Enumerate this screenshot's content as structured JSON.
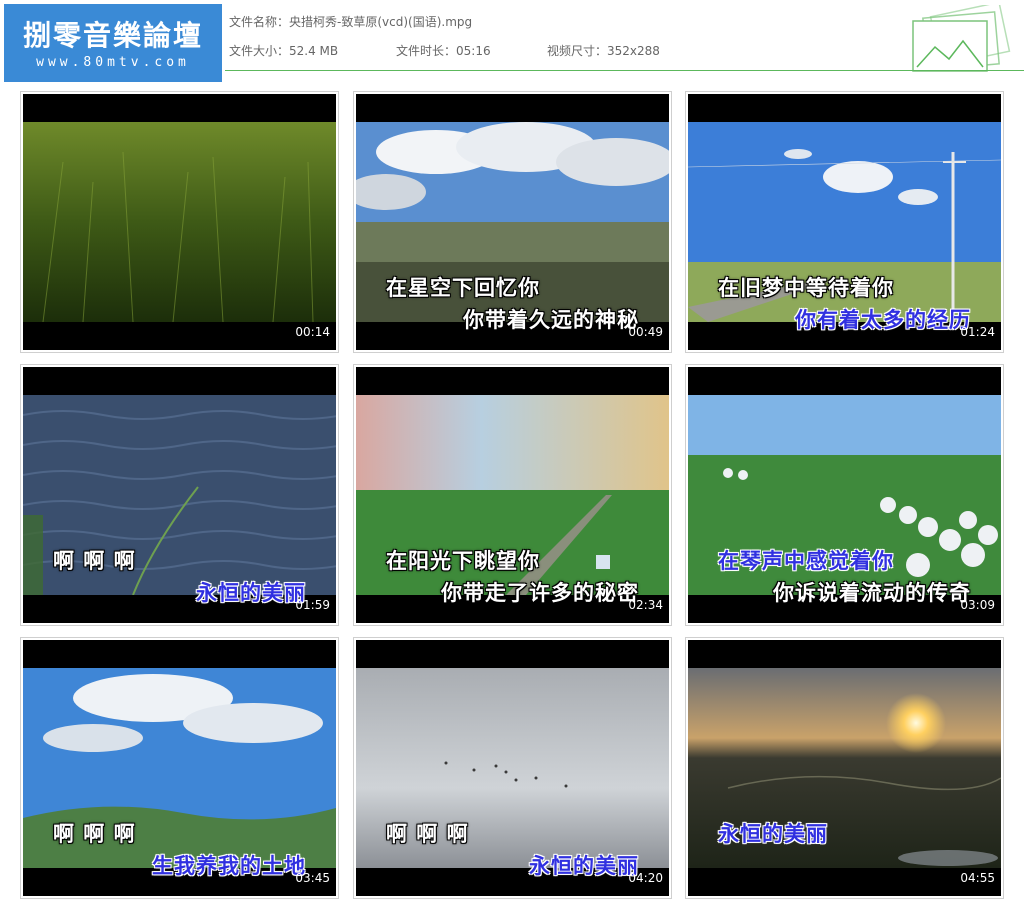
{
  "logo": {
    "title": "捌零音樂論壇",
    "url": "www.80mtv.com"
  },
  "file_info": {
    "name_label": "文件名称：",
    "name_value": "央措柯秀-致草原(vcd)(国语).mpg",
    "size_label": "文件大小：",
    "size_value": "52.4 MB",
    "duration_label": "文件时长：",
    "duration_value": "05:16",
    "resolution_label": "视频尺寸：",
    "resolution_value": "352x288"
  },
  "thumbnails": [
    {
      "time": "00:14",
      "lyric_line1": "",
      "lyric_line2": ""
    },
    {
      "time": "00:49",
      "lyric_line1": "在星空下回忆你",
      "lyric_line2": "你带着久远的神秘"
    },
    {
      "time": "01:24",
      "lyric_line1": "在旧梦中等待着你",
      "lyric_line2": "你有着太多的经历"
    },
    {
      "time": "01:59",
      "lyric_line1": "啊 啊 啊",
      "lyric_line2": "永恒的美丽"
    },
    {
      "time": "02:34",
      "lyric_line1": "在阳光下眺望你",
      "lyric_line2": "你带走了许多的秘密"
    },
    {
      "time": "03:09",
      "lyric_line1": "在琴声中感觉着你",
      "lyric_line2": "你诉说着流动的传奇"
    },
    {
      "time": "03:45",
      "lyric_line1": "啊 啊 啊",
      "lyric_line2": "生我养我的土地"
    },
    {
      "time": "04:20",
      "lyric_line1": "啊 啊 啊",
      "lyric_line2": "永恒的美丽"
    },
    {
      "time": "04:55",
      "lyric_line1": "永恒的美丽",
      "lyric_line2": ""
    }
  ]
}
